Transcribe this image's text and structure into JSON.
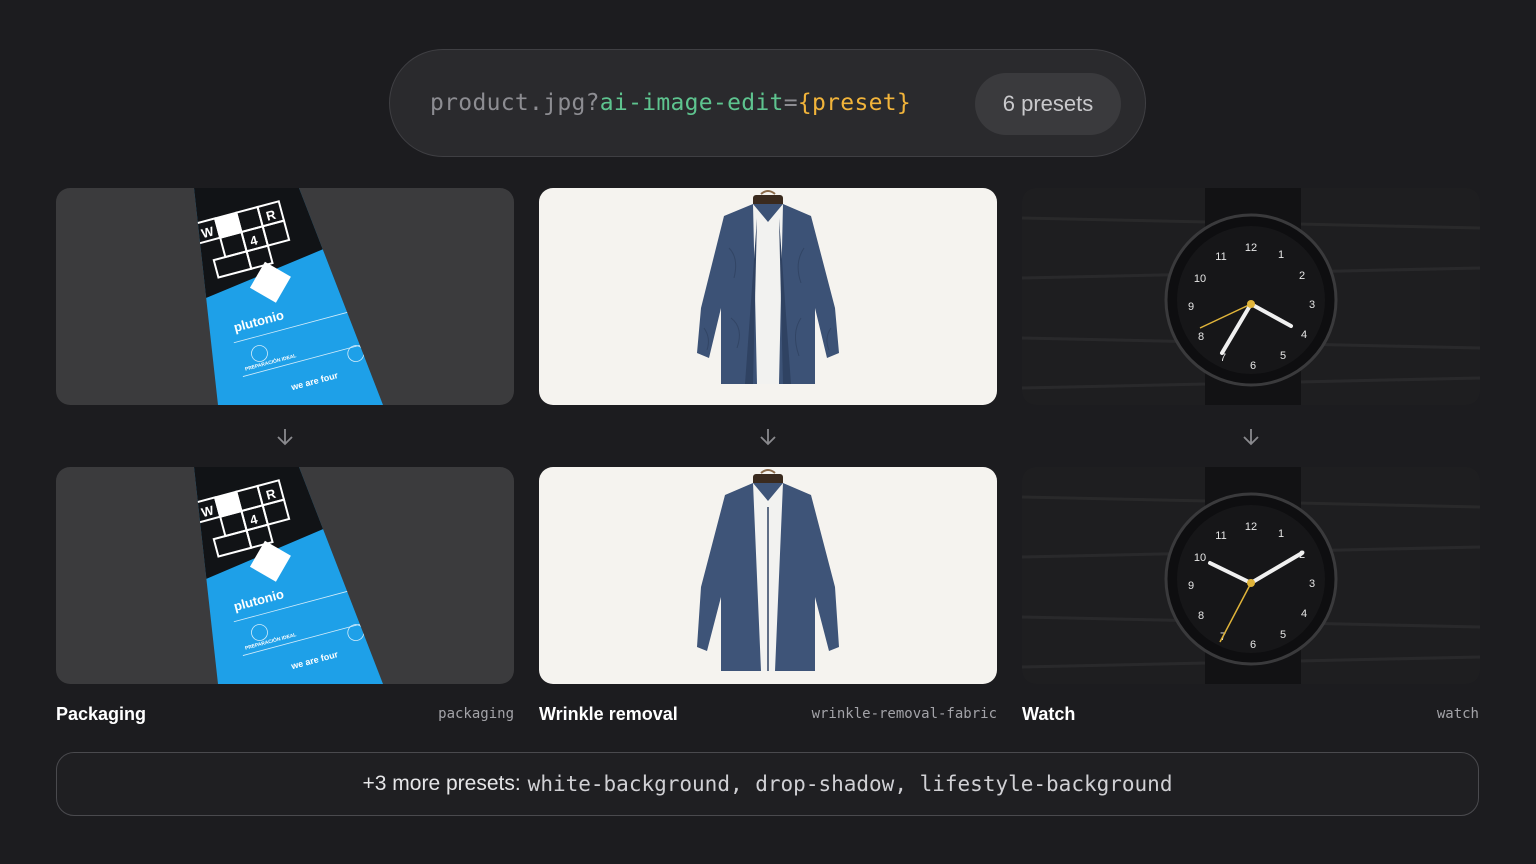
{
  "header": {
    "url_base": "product.jpg?",
    "url_param": "ai-image-edit",
    "url_eq": "=",
    "url_preset": "{preset}",
    "preset_count": "6 presets"
  },
  "presets": [
    {
      "label": "Packaging",
      "slug": "packaging"
    },
    {
      "label": "Wrinkle removal",
      "slug": "wrinkle-removal-fabric"
    },
    {
      "label": "Watch",
      "slug": "watch"
    }
  ],
  "packaging_art": {
    "brand": "plutonio",
    "tagline": "we are four",
    "letters": [
      "W",
      "4",
      "R"
    ],
    "prep": "PREPARACIÓN IDEAL"
  },
  "watch_dial": [
    "12",
    "1",
    "2",
    "3",
    "4",
    "5",
    "6",
    "7",
    "8",
    "9",
    "10",
    "11"
  ],
  "more_presets": {
    "prefix": "+3 more presets:",
    "list": "white-background, drop-shadow, lifestyle-background"
  },
  "colors": {
    "background": "#1c1c1f",
    "param_green": "#5ec48f",
    "preset_yellow": "#f2b43a",
    "packaging_blue": "#1ea0e8"
  },
  "icons": [
    "arrow-down-icon"
  ]
}
